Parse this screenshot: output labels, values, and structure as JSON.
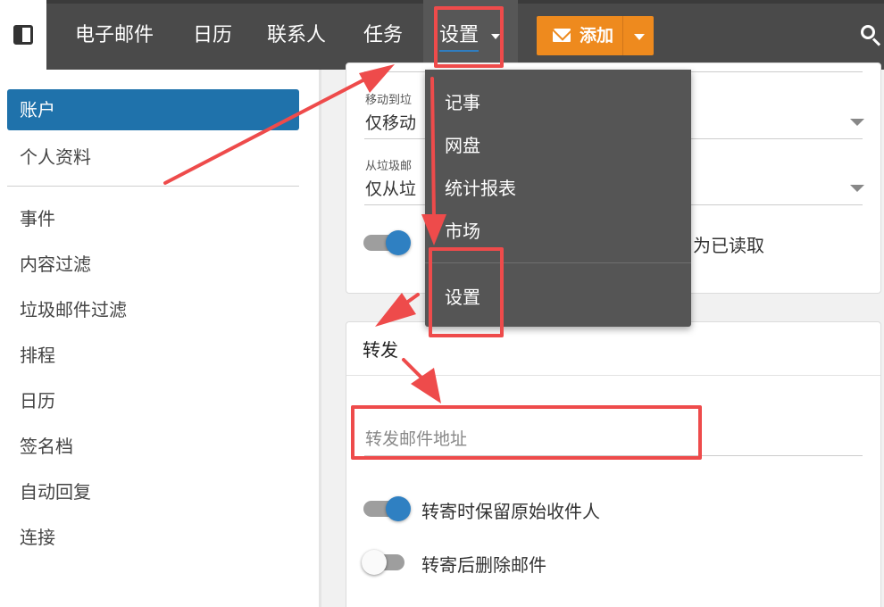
{
  "nav": {
    "items": [
      "电子邮件",
      "日历",
      "联系人",
      "任务"
    ],
    "settings_label": "设置",
    "add_label": "添加"
  },
  "sidebar": {
    "items": [
      {
        "label": "账户",
        "active": true
      },
      {
        "label": "个人资料"
      },
      {
        "label": "事件"
      },
      {
        "label": "内容过滤"
      },
      {
        "label": "垃圾邮件过滤"
      },
      {
        "label": "排程"
      },
      {
        "label": "日历"
      },
      {
        "label": "签名档"
      },
      {
        "label": "自动回复"
      },
      {
        "label": "连接"
      }
    ]
  },
  "content": {
    "field1_label": "移动到垃",
    "field1_value": "仅移动",
    "field2_label": "从垃圾邮",
    "field2_value": "仅从垃",
    "toggle_text_partial": "为已读取",
    "forward": {
      "title": "转发",
      "address_placeholder": "转发邮件地址",
      "keep_recipients": "转寄时保留原始收件人",
      "delete_after": "转寄后删除邮件"
    }
  },
  "dropdown": {
    "items": [
      "记事",
      "网盘",
      "统计报表",
      "市场"
    ],
    "settings_item": "设置"
  },
  "colors": {
    "nav_bg": "#4a4a4a",
    "add_button": "#ee8a1e",
    "active_sidebar": "#1f72ab",
    "toggle_on": "#2f80c2",
    "annotation_red": "#ee4b4b"
  }
}
